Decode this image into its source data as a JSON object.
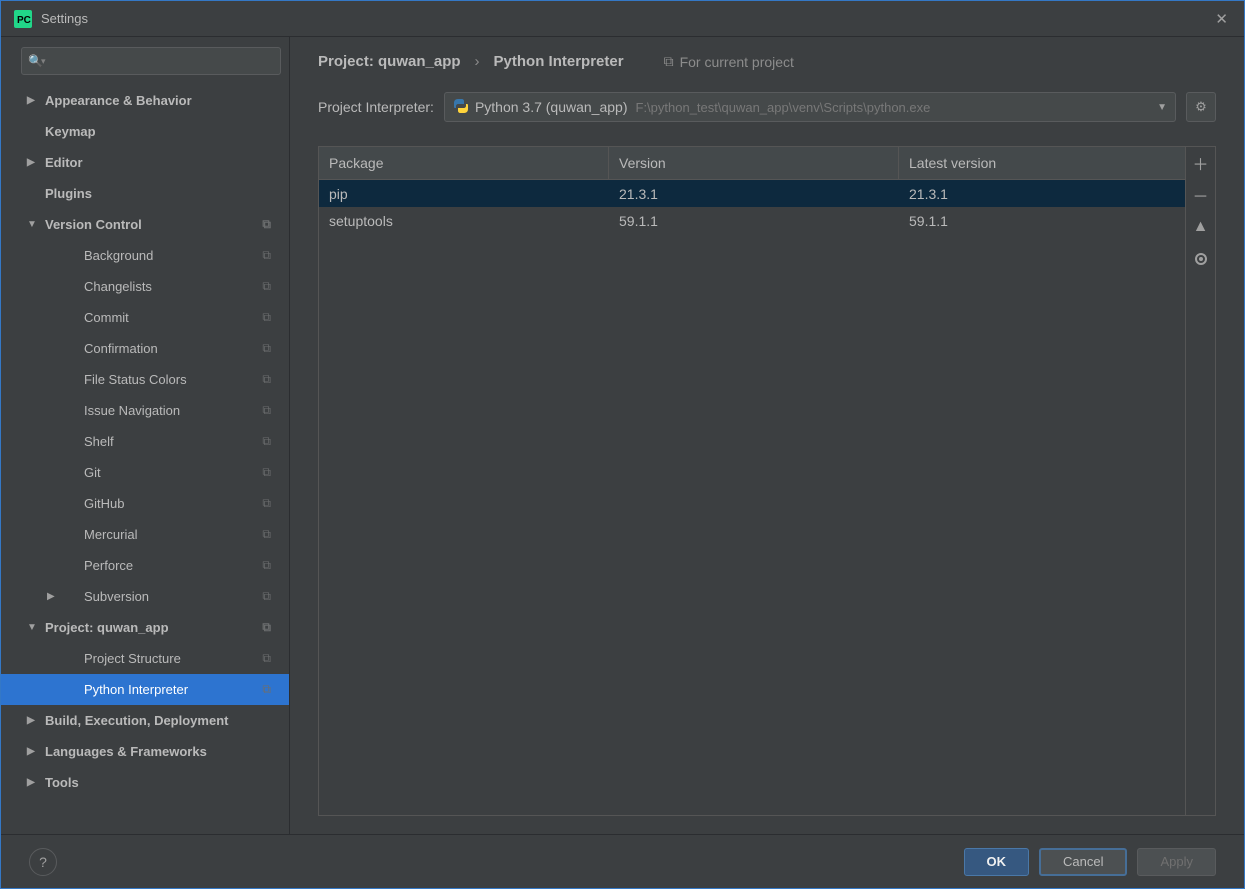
{
  "window": {
    "title": "Settings"
  },
  "sidebar": {
    "search_placeholder": "",
    "items": [
      {
        "label": "Appearance & Behavior",
        "bold": true,
        "arrow": "right"
      },
      {
        "label": "Keymap",
        "bold": true
      },
      {
        "label": "Editor",
        "bold": true,
        "arrow": "right"
      },
      {
        "label": "Plugins",
        "bold": true
      },
      {
        "label": "Version Control",
        "bold": true,
        "arrow": "down",
        "badge": true
      },
      {
        "label": "Background",
        "sub": true,
        "badge": true
      },
      {
        "label": "Changelists",
        "sub": true,
        "badge": true
      },
      {
        "label": "Commit",
        "sub": true,
        "badge": true
      },
      {
        "label": "Confirmation",
        "sub": true,
        "badge": true
      },
      {
        "label": "File Status Colors",
        "sub": true,
        "badge": true
      },
      {
        "label": "Issue Navigation",
        "sub": true,
        "badge": true
      },
      {
        "label": "Shelf",
        "sub": true,
        "badge": true
      },
      {
        "label": "Git",
        "sub": true,
        "badge": true
      },
      {
        "label": "GitHub",
        "sub": true,
        "badge": true
      },
      {
        "label": "Mercurial",
        "sub": true,
        "badge": true
      },
      {
        "label": "Perforce",
        "sub": true,
        "badge": true
      },
      {
        "label": "Subversion",
        "sub": true,
        "arrow": "right",
        "arrowSub": true,
        "badge": true
      },
      {
        "label": "Project: quwan_app",
        "bold": true,
        "arrow": "down",
        "badge": true
      },
      {
        "label": "Project Structure",
        "sub": true,
        "badge": true
      },
      {
        "label": "Python Interpreter",
        "sub": true,
        "badge": true,
        "selected": true
      },
      {
        "label": "Build, Execution, Deployment",
        "bold": true,
        "arrow": "right"
      },
      {
        "label": "Languages & Frameworks",
        "bold": true,
        "arrow": "right"
      },
      {
        "label": "Tools",
        "bold": true,
        "arrow": "right"
      }
    ]
  },
  "breadcrumb": {
    "crumb1": "Project: quwan_app",
    "crumb2": "Python Interpreter",
    "hint": "For current project"
  },
  "interpreter": {
    "label": "Project Interpreter:",
    "name": "Python 3.7 (quwan_app)",
    "path": "F:\\python_test\\quwan_app\\venv\\Scripts\\python.exe"
  },
  "table": {
    "headers": {
      "c1": "Package",
      "c2": "Version",
      "c3": "Latest version"
    },
    "rows": [
      {
        "package": "pip",
        "version": "21.3.1",
        "latest": "21.3.1",
        "selected": true
      },
      {
        "package": "setuptools",
        "version": "59.1.1",
        "latest": "59.1.1"
      }
    ]
  },
  "buttons": {
    "ok": "OK",
    "cancel": "Cancel",
    "apply": "Apply"
  }
}
